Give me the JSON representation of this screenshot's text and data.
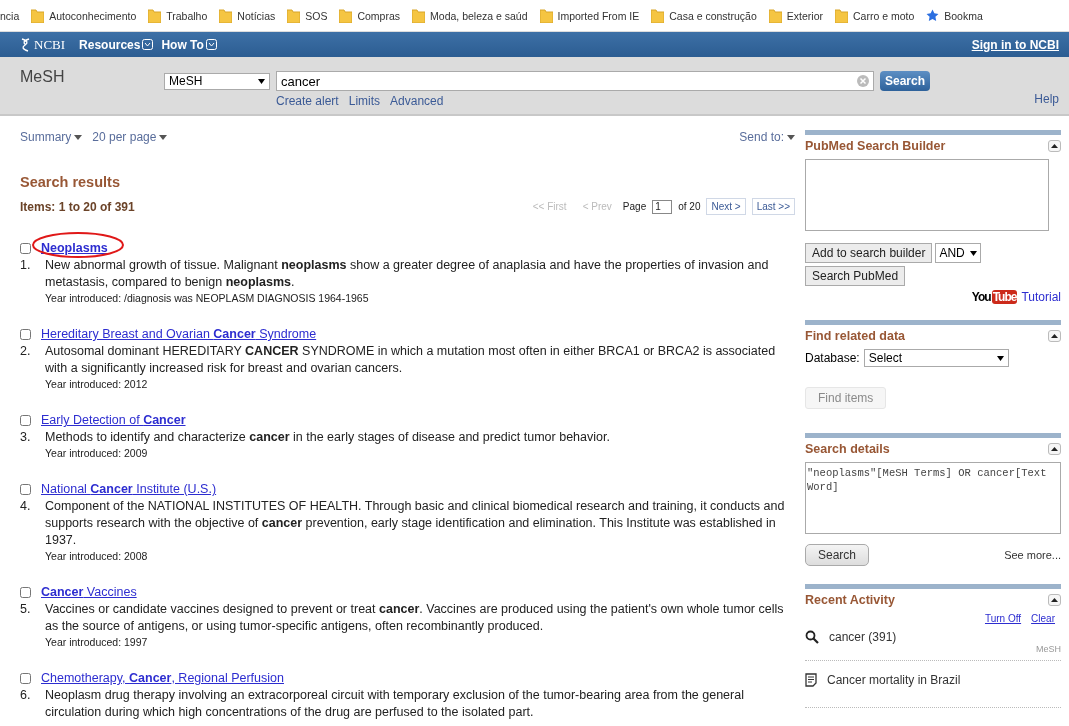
{
  "bookmarks": [
    {
      "label": "ncia",
      "kind": "text"
    },
    {
      "label": "Autoconhecimento",
      "kind": "folder"
    },
    {
      "label": "Trabalho",
      "kind": "folder"
    },
    {
      "label": "Notícias",
      "kind": "folder"
    },
    {
      "label": "SOS",
      "kind": "folder"
    },
    {
      "label": "Compras",
      "kind": "folder"
    },
    {
      "label": "Moda, beleza e saúd",
      "kind": "folder"
    },
    {
      "label": "Imported From IE",
      "kind": "folder"
    },
    {
      "label": "Casa e construção",
      "kind": "folder"
    },
    {
      "label": "Exterior",
      "kind": "folder"
    },
    {
      "label": "Carro e moto",
      "kind": "folder"
    },
    {
      "label": "Bookma",
      "kind": "star"
    }
  ],
  "header": {
    "logo": "NCBI",
    "menus": [
      "Resources",
      "How To"
    ],
    "sign_in": "Sign in to NCBI"
  },
  "search": {
    "database": "MeSH",
    "db_select": "MeSH",
    "query": "cancer",
    "button": "Search",
    "links": [
      "Create alert",
      "Limits",
      "Advanced"
    ],
    "help": "Help"
  },
  "toolbar": {
    "format": "Summary",
    "per_page": "20 per page",
    "send_to": "Send to:"
  },
  "results_heading": "Search results",
  "items_count": "Items: 1 to 20 of 391",
  "pager": {
    "buttons": [
      {
        "label": "<< First",
        "disabled": true
      },
      {
        "label": "< Prev",
        "disabled": true
      }
    ],
    "page_label": "Page",
    "page": "1",
    "of": "of 20",
    "next_buttons": [
      {
        "label": "Next >",
        "disabled": false
      },
      {
        "label": "Last >>",
        "disabled": false
      }
    ]
  },
  "results": [
    {
      "number": "1.",
      "title": "Neoplasms",
      "bold": true,
      "circled": true,
      "checked": false,
      "description": "New abnormal growth of tissue. Malignant **neoplasms** show a greater degree of anaplasia and have the properties of invasion and metastasis, compared to benign **neoplasms**.",
      "year": "Year introduced: /diagnosis was NEOPLASM DIAGNOSIS 1964-1965"
    },
    {
      "number": "2.",
      "title": "Hereditary Breast and Ovarian **Cancer** Syndrome",
      "bold": false,
      "circled": false,
      "checked": false,
      "description": "Autosomal dominant HEREDITARY **CANCER** SYNDROME in which a mutation most often in either BRCA1 or BRCA2 is associated with a significantly increased risk for breast and ovarian cancers.",
      "year": "Year introduced: 2012"
    },
    {
      "number": "3.",
      "title": "Early Detection of **Cancer**",
      "bold": false,
      "circled": false,
      "checked": false,
      "description": "Methods to identify and characterize **cancer** in the early stages of disease and predict tumor behavior.",
      "year": "Year introduced: 2009"
    },
    {
      "number": "4.",
      "title": "National **Cancer** Institute (U.S.)",
      "bold": false,
      "circled": false,
      "checked": false,
      "description": "Component of the NATIONAL INSTITUTES OF HEALTH. Through basic and clinical biomedical research and training, it conducts and supports research with the objective of **cancer** prevention, early stage identification and elimination. This Institute was established in 1937.",
      "year": "Year introduced: 2008"
    },
    {
      "number": "5.",
      "title": "**Cancer** Vaccines",
      "bold": false,
      "circled": false,
      "checked": false,
      "description": "Vaccines or candidate vaccines designed to prevent or treat **cancer**. Vaccines are produced using the patient's own whole tumor cells as the source of antigens, or using tumor-specific antigens, often recombinantly produced.",
      "year": "Year introduced: 1997"
    },
    {
      "number": "6.",
      "title": "Chemotherapy, **Cancer**, Regional Perfusion",
      "bold": false,
      "circled": false,
      "checked": false,
      "description": "Neoplasm drug therapy involving an extracorporeal circuit with temporary exclusion of the tumor-bearing area from the general circulation during which high concentrations of the drug are perfused to the isolated part."
    }
  ],
  "sidebar": [
    {
      "kind": "builder",
      "title": "PubMed Search Builder",
      "add_button": "Add to search builder",
      "operator": "AND",
      "search_button": "Search PubMed",
      "logo": [
        "You",
        "Tube"
      ],
      "tutorial": "Tutorial"
    },
    {
      "kind": "related",
      "title": "Find related data",
      "database_label": "Database:",
      "database": "Select",
      "find_button": "Find items",
      "disabled": true
    },
    {
      "kind": "details",
      "title": "Search details",
      "query": "\"neoplasms\"[MeSH Terms] OR cancer[Text Word]",
      "search_button": "Search",
      "see_more": "See more..."
    },
    {
      "kind": "recent",
      "title": "Recent Activity",
      "links": [
        "Turn Off",
        "Clear"
      ],
      "items": [
        {
          "kind": "search",
          "text": "cancer (391)",
          "db": "MeSH"
        },
        {
          "kind": "document",
          "text": "Cancer mortality in Brazil"
        }
      ]
    }
  ]
}
